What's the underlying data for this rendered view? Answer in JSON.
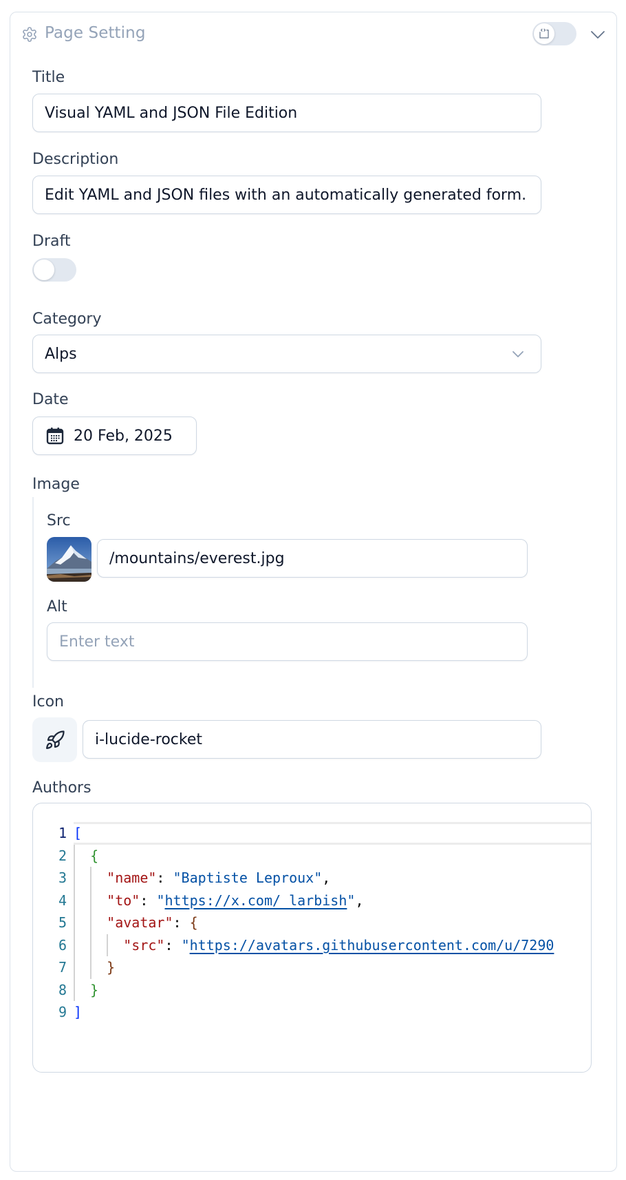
{
  "panel": {
    "title": "Page Setting",
    "icon": "gear-icon",
    "mode_toggle": {
      "state": "off",
      "icon": "file-code-icon"
    },
    "collapse_icon": "chevron-down-icon"
  },
  "fields": {
    "title": {
      "label": "Title",
      "value": "Visual YAML and JSON File Edition"
    },
    "description": {
      "label": "Description",
      "value": "Edit YAML and JSON files with an automatically generated form."
    },
    "draft": {
      "label": "Draft",
      "value": false
    },
    "category": {
      "label": "Category",
      "value": "Alps",
      "icon": "chevron-down-icon"
    },
    "date": {
      "label": "Date",
      "value": "20 Feb, 2025",
      "icon": "calendar-icon"
    },
    "image": {
      "label": "Image",
      "src": {
        "label": "Src",
        "value": "/mountains/everest.jpg",
        "thumbnail": "mountain-thumbnail"
      },
      "alt": {
        "label": "Alt",
        "value": "",
        "placeholder": "Enter text"
      }
    },
    "icon": {
      "label": "Icon",
      "value": "i-lucide-rocket",
      "preview_icon": "rocket-icon"
    },
    "authors": {
      "label": "Authors",
      "lines": [
        {
          "n": "1",
          "tokens": [
            {
              "t": "[",
              "c": "tk-bracket1"
            }
          ]
        },
        {
          "n": "2",
          "tokens": [
            {
              "t": "  "
            },
            {
              "t": "{",
              "c": "tk-bracket2"
            }
          ]
        },
        {
          "n": "3",
          "tokens": [
            {
              "t": "    "
            },
            {
              "t": "\"name\"",
              "c": "tk-key"
            },
            {
              "t": ": ",
              "c": "tk-punc"
            },
            {
              "t": "\"Baptiste Leproux\"",
              "c": "tk-str"
            },
            {
              "t": ",",
              "c": "tk-punc"
            }
          ]
        },
        {
          "n": "4",
          "tokens": [
            {
              "t": "    "
            },
            {
              "t": "\"to\"",
              "c": "tk-key"
            },
            {
              "t": ": ",
              "c": "tk-punc"
            },
            {
              "t": "\"",
              "c": "tk-str"
            },
            {
              "t": "https://x.com/_larbish",
              "c": "tk-link"
            },
            {
              "t": "\"",
              "c": "tk-str"
            },
            {
              "t": ",",
              "c": "tk-punc"
            }
          ]
        },
        {
          "n": "5",
          "tokens": [
            {
              "t": "    "
            },
            {
              "t": "\"avatar\"",
              "c": "tk-key"
            },
            {
              "t": ": ",
              "c": "tk-punc"
            },
            {
              "t": "{",
              "c": "tk-bracket3"
            }
          ]
        },
        {
          "n": "6",
          "tokens": [
            {
              "t": "      "
            },
            {
              "t": "\"src\"",
              "c": "tk-key"
            },
            {
              "t": ": ",
              "c": "tk-punc"
            },
            {
              "t": "\"",
              "c": "tk-str"
            },
            {
              "t": "https://avatars.githubusercontent.com/u/7290",
              "c": "tk-link"
            }
          ]
        },
        {
          "n": "7",
          "tokens": [
            {
              "t": "    "
            },
            {
              "t": "}",
              "c": "tk-bracket3"
            }
          ]
        },
        {
          "n": "8",
          "tokens": [
            {
              "t": "  "
            },
            {
              "t": "}",
              "c": "tk-bracket2"
            }
          ]
        },
        {
          "n": "9",
          "tokens": [
            {
              "t": "]",
              "c": "tk-bracket1"
            }
          ]
        }
      ],
      "active_line": 1
    }
  }
}
